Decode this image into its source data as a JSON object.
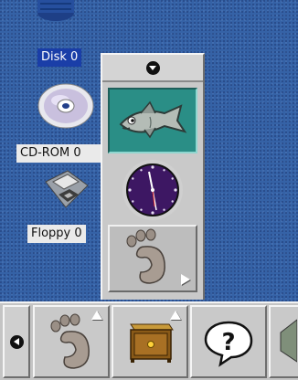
{
  "desktop": {
    "icons": [
      {
        "label": "Disk 0",
        "icon": "hard-disk-icon",
        "selected": true
      },
      {
        "label": "CD-ROM 0",
        "icon": "cdrom-icon",
        "selected": false
      },
      {
        "label": "Floppy 0",
        "icon": "floppy-icon",
        "selected": false
      }
    ]
  },
  "drawer": {
    "handle_icon": "arrow-down-icon",
    "items": [
      {
        "icon": "fish-icon"
      },
      {
        "icon": "clock-icon"
      },
      {
        "icon": "gnome-foot-icon"
      }
    ]
  },
  "panel": {
    "hide_icon": "arrow-left-icon",
    "launchers": [
      {
        "icon": "gnome-foot-menu-icon"
      },
      {
        "icon": "drawer-icon"
      },
      {
        "icon": "help-icon"
      },
      {
        "icon": "partial-launcher-icon"
      }
    ]
  },
  "colors": {
    "desktop": "#3562a6",
    "selection": "#1a3ea8",
    "panel": "#c4c4c4",
    "fish_tile": "#2a8e86",
    "clock_face": "#3d1763"
  }
}
